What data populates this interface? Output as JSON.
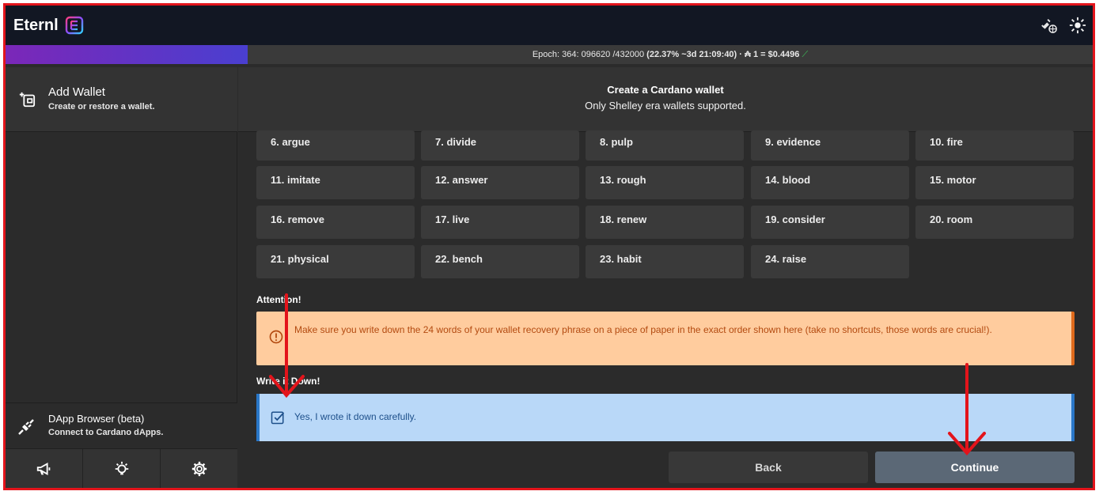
{
  "app": {
    "name": "Eternl"
  },
  "epoch": {
    "prefix": "Epoch: 364: 096620 /432000 ",
    "progress_text": "(22.37% ~3d 21:09:40)",
    "price_text": " · ₳ 1 = $0.4496",
    "progress": 0.2237
  },
  "sidebar": {
    "add_wallet_title": "Add Wallet",
    "add_wallet_sub": "Create or restore a wallet.",
    "dapp_title": "DApp Browser (beta)",
    "dapp_sub": "Connect to Cardano dApps."
  },
  "main": {
    "title": "Create a Cardano wallet",
    "subtitle": "Only Shelley era wallets supported."
  },
  "words": [
    "6. argue",
    "7. divide",
    "8. pulp",
    "9. evidence",
    "10. fire",
    "11. imitate",
    "12. answer",
    "13. rough",
    "14. blood",
    "15. motor",
    "16. remove",
    "17. live",
    "18. renew",
    "19. consider",
    "20. room",
    "21. physical",
    "22. bench",
    "23. habit",
    "24. raise"
  ],
  "attention": {
    "label": "Attention!",
    "text": "Make sure you write down the 24 words of your wallet recovery phrase on a piece of paper in the exact order shown here (take no shortcuts, those words are crucial!)."
  },
  "write_down": {
    "label": "Write it Down!",
    "checkbox_label": "Yes, I wrote it down carefully.",
    "checked": true
  },
  "buttons": {
    "back": "Back",
    "continue": "Continue"
  },
  "colors": {
    "accent_purple": "#7b27b8",
    "warning_bg": "#ffcc9e",
    "info_bg": "#b9d8f8",
    "annotation_red": "#e3141b"
  }
}
